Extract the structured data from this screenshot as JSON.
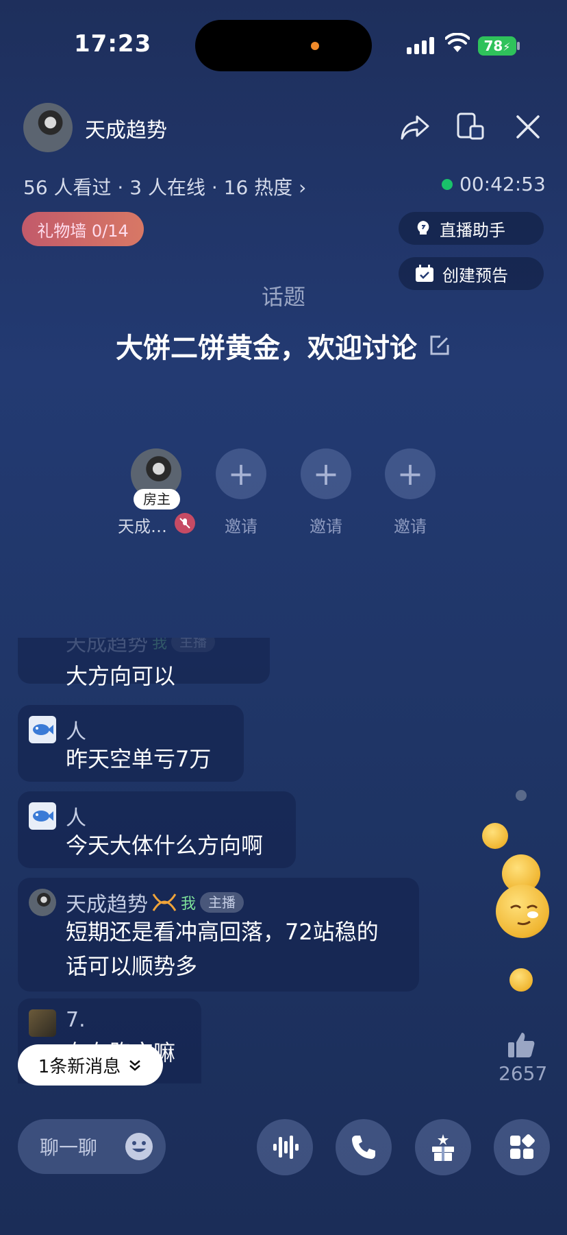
{
  "status_bar": {
    "time": "17:23",
    "battery": "78"
  },
  "header": {
    "room_name": "天成趋势",
    "stats": "56 人看过 · 3 人在线 · 16 热度 ›",
    "timer": "00:42:53"
  },
  "gift_wall": {
    "label": "礼物墙 0/14"
  },
  "tools": {
    "assistant": "直播助手",
    "schedule": "创建预告"
  },
  "topic": {
    "label": "话题",
    "title": "大饼二饼黄金，欢迎讨论"
  },
  "seats": {
    "host_tag": "房主",
    "host_name": "天成…",
    "invite_label": "邀请"
  },
  "chat": {
    "partial_message": {
      "name": "天成趋势",
      "me": "我",
      "role": "主播",
      "text": "大方向可以"
    },
    "messages": [
      {
        "name": "人",
        "text": "昨天空单亏7万"
      },
      {
        "name": "人",
        "text": "今天大体什么方向啊"
      },
      {
        "name": "天成趋势",
        "me": "我",
        "role": "主播",
        "text_line1": "短期还是看冲高回落，72站稳的",
        "text_line2": "话可以顺势多"
      },
      {
        "name": "7.",
        "text": "有在跑空嘛"
      }
    ],
    "new_message": "1条新消息"
  },
  "likes": {
    "count": "2657"
  },
  "bottom_bar": {
    "chat_placeholder": "聊一聊"
  }
}
